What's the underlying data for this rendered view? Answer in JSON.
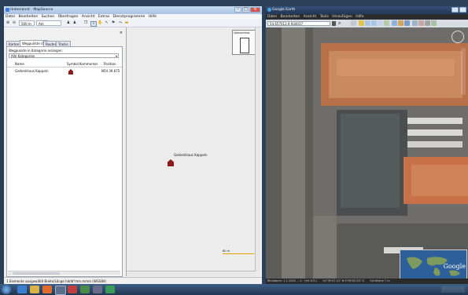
{
  "left_window": {
    "title": "Unbenannt - MapSource",
    "menu": [
      "Datei",
      "Bearbeiten",
      "Suchen",
      "Übertragen",
      "Ansicht",
      "Extras",
      "Dienstprogramme",
      "Hilfe"
    ],
    "zoom_value": "500 m",
    "map_type": "Am höchsten",
    "tabs": [
      "Karten",
      "Wegpunkte (1)",
      "Routen",
      "Tracks"
    ],
    "category_label": "Wegpunkte in Kategorie anzeigen:",
    "category_value": "Alle Kategorien",
    "columns": [
      "Name",
      "Symbol",
      "Kommentar",
      "Position"
    ],
    "rows": [
      {
        "name": "Gedenkhaus Kappeln",
        "comment": "",
        "position": "N54 39.675"
      }
    ],
    "overview_label": "Übersichtsk",
    "map_marker_label": "Gedenkhaus Kappeln",
    "scale_label": "80 m",
    "status": "1 Elemente ausgewählt  Breite/Länge hddd°mm.mmm (WGS84)"
  },
  "right_window": {
    "title": "Google Earth",
    "menu": [
      "Datei",
      "Bearbeiten",
      "Ansicht",
      "Tools",
      "Hinzufügen",
      "Hilfe"
    ],
    "search_value": "54.657012,9.934017",
    "status_left": "Bilddatum: 1.1.2000 ... 4 · Okt 2011",
    "status_coords": "54°39'47.10\" N  9°56'02.55\" O",
    "status_alt": "Sichthöhe 7 m",
    "logo": "Google"
  },
  "colors": {
    "taskbar": "#203650",
    "titlebar": "#a8c3e3",
    "marker": "#8b1a1a"
  }
}
